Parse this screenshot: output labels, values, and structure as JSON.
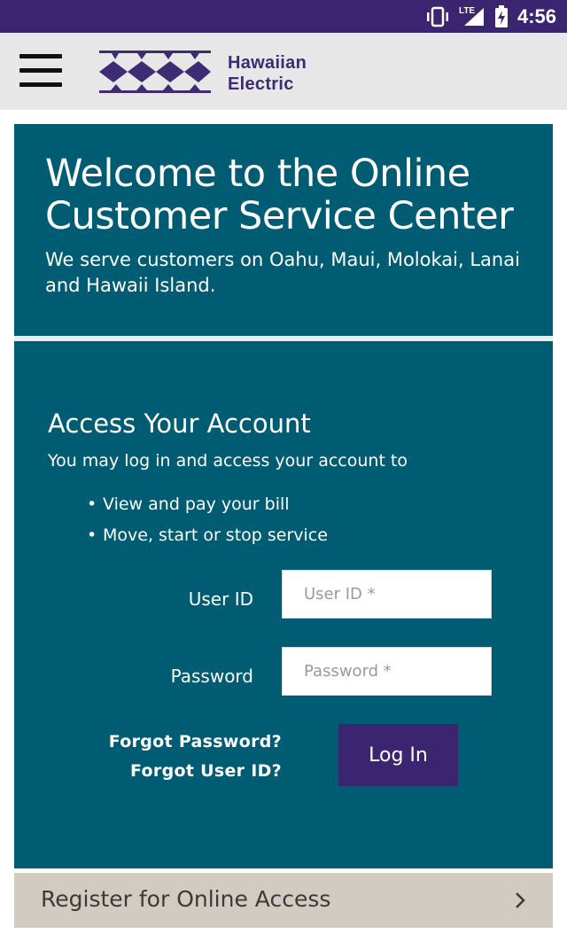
{
  "status_bar": {
    "time": "4:56",
    "network": "LTE",
    "icons": [
      "vibrate-icon",
      "signal-icon",
      "battery-charging-icon"
    ]
  },
  "app_bar": {
    "menu_icon": "hamburger-menu-icon",
    "logo": {
      "line1": "Hawaiian",
      "line2": "Electric"
    }
  },
  "welcome": {
    "title_line1": "Welcome to the Online",
    "title_line2": "Customer Service Center",
    "subtitle_line1": "We serve customers on Oahu, Maui, Molokai, Lanai",
    "subtitle_line2": "and Hawaii Island."
  },
  "login": {
    "heading": "Access Your Account",
    "intro": "You may log in and access your account to",
    "bullets": [
      "View and pay your bill",
      "Move, start or stop service"
    ],
    "user_id_label": "User ID",
    "user_id_placeholder": "User ID *",
    "user_id_value": "",
    "password_label": "Password",
    "password_placeholder": "Password *",
    "password_value": "",
    "forgot_password": "Forgot Password?",
    "forgot_user_id": "Forgot User ID?",
    "login_button": "Log In"
  },
  "register": {
    "label": "Register for Online Access",
    "icon": "chevron-right-icon"
  },
  "colors": {
    "status_bar": "#3b2570",
    "app_bar": "#e7e7e7",
    "panel_teal": "#005c73",
    "brand_purple": "#3b2570",
    "register_bg": "#d2cbc1"
  }
}
